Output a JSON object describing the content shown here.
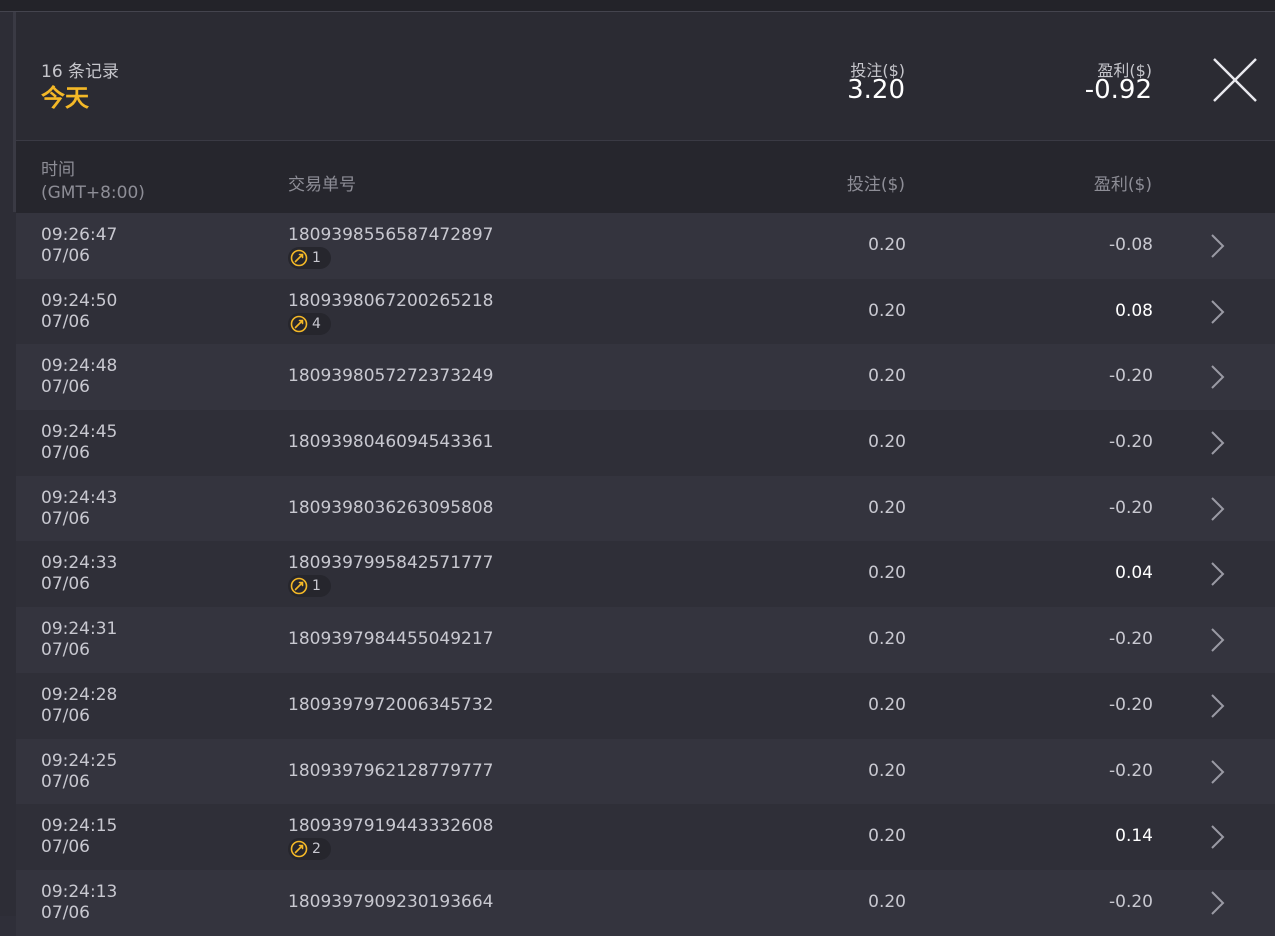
{
  "summary": {
    "count_text": "16 条记录",
    "period": "今天",
    "bet_label": "投注($)",
    "bet_total": "3.20",
    "profit_label": "盈利($)",
    "profit_total": "-0.92"
  },
  "columns": {
    "time": "时间",
    "timezone": "(GMT+8:00)",
    "order_id": "交易单号",
    "bet": "投注($)",
    "profit": "盈利($)"
  },
  "colors": {
    "accent": "#f4b827",
    "positive": "#ffffff",
    "text": "#c8c8d0"
  },
  "rows": [
    {
      "time": "09:26:47",
      "date": "07/06",
      "id": "1809398556587472897",
      "badge": "1",
      "bet": "0.20",
      "profit": "-0.08",
      "positive": false
    },
    {
      "time": "09:24:50",
      "date": "07/06",
      "id": "1809398067200265218",
      "badge": "4",
      "bet": "0.20",
      "profit": "0.08",
      "positive": true
    },
    {
      "time": "09:24:48",
      "date": "07/06",
      "id": "1809398057272373249",
      "badge": "",
      "bet": "0.20",
      "profit": "-0.20",
      "positive": false
    },
    {
      "time": "09:24:45",
      "date": "07/06",
      "id": "1809398046094543361",
      "badge": "",
      "bet": "0.20",
      "profit": "-0.20",
      "positive": false
    },
    {
      "time": "09:24:43",
      "date": "07/06",
      "id": "1809398036263095808",
      "badge": "",
      "bet": "0.20",
      "profit": "-0.20",
      "positive": false
    },
    {
      "time": "09:24:33",
      "date": "07/06",
      "id": "1809397995842571777",
      "badge": "1",
      "bet": "0.20",
      "profit": "0.04",
      "positive": true
    },
    {
      "time": "09:24:31",
      "date": "07/06",
      "id": "1809397984455049217",
      "badge": "",
      "bet": "0.20",
      "profit": "-0.20",
      "positive": false
    },
    {
      "time": "09:24:28",
      "date": "07/06",
      "id": "1809397972006345732",
      "badge": "",
      "bet": "0.20",
      "profit": "-0.20",
      "positive": false
    },
    {
      "time": "09:24:25",
      "date": "07/06",
      "id": "1809397962128779777",
      "badge": "",
      "bet": "0.20",
      "profit": "-0.20",
      "positive": false
    },
    {
      "time": "09:24:15",
      "date": "07/06",
      "id": "1809397919443332608",
      "badge": "2",
      "bet": "0.20",
      "profit": "0.14",
      "positive": true
    },
    {
      "time": "09:24:13",
      "date": "07/06",
      "id": "1809397909230193664",
      "badge": "",
      "bet": "0.20",
      "profit": "-0.20",
      "positive": false
    }
  ]
}
